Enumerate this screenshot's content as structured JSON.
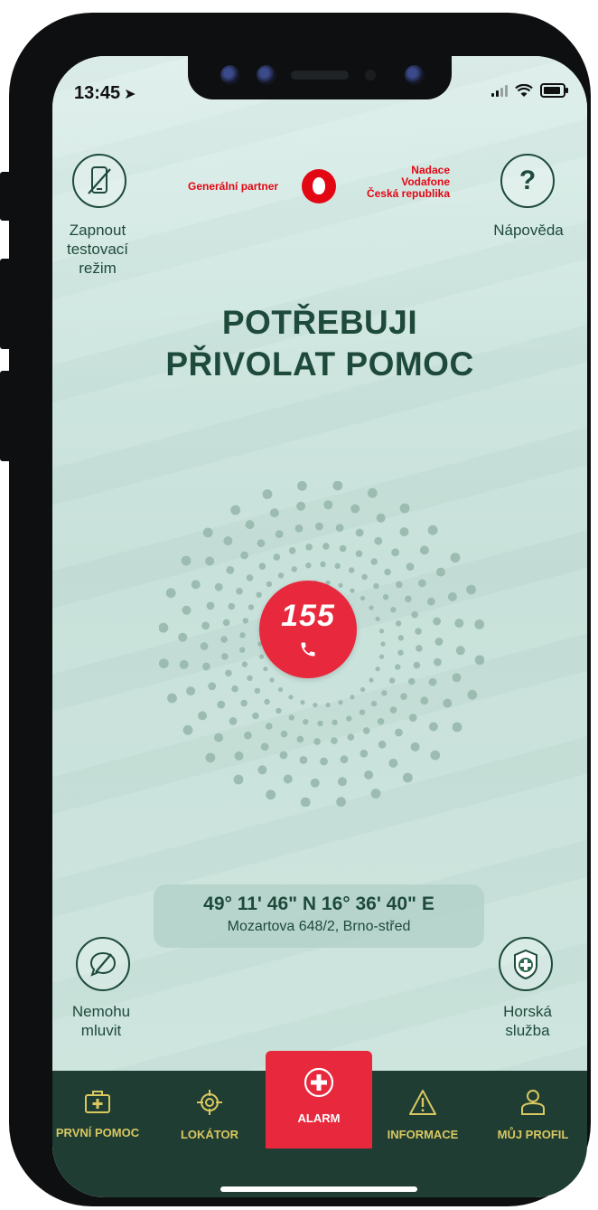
{
  "status_bar": {
    "time": "13:45"
  },
  "sponsor": {
    "partner_label": "Generální partner",
    "nadace_lines": [
      "Nadace",
      "Vodafone",
      "Česká republika"
    ]
  },
  "top_left": {
    "label_lines": [
      "Zapnout",
      "testovací",
      "režim"
    ]
  },
  "top_right": {
    "label": "Nápověda",
    "icon_text": "?"
  },
  "headline": {
    "line1": "POTŘEBUJI",
    "line2": "PŘIVOLAT POMOC"
  },
  "alarm": {
    "number": "155"
  },
  "location": {
    "coords": "49° 11' 46\" N 16° 36' 40\" E",
    "address": "Mozartova 648/2, Brno-střed"
  },
  "bottom_left": {
    "label_lines": [
      "Nemohu",
      "mluvit"
    ]
  },
  "bottom_right": {
    "label_lines": [
      "Horská",
      "služba"
    ]
  },
  "tabs": [
    {
      "label": "PRVNÍ POMOC",
      "icon": "first-aid-kit-icon"
    },
    {
      "label": "LOKÁTOR",
      "icon": "crosshair-icon"
    },
    {
      "label": "ALARM",
      "icon": "plus-circle-icon"
    },
    {
      "label": "INFORMACE",
      "icon": "warning-icon"
    },
    {
      "label": "MŮJ PROFIL",
      "icon": "user-icon"
    }
  ],
  "colors": {
    "accent": "#e8283c",
    "primary": "#1e4a3b",
    "tabbar": "#1f3d33",
    "tab_text": "#d9c860"
  }
}
